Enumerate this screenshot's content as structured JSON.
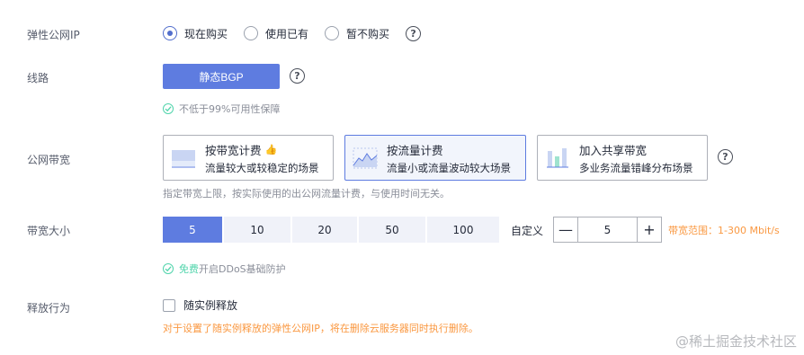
{
  "eip": {
    "label": "弹性公网IP",
    "options": [
      {
        "label": "现在购买",
        "selected": true
      },
      {
        "label": "使用已有",
        "selected": false
      },
      {
        "label": "暂不购买",
        "selected": false
      }
    ]
  },
  "line": {
    "label": "线路",
    "button": "静态BGP",
    "note": "不低于99%可用性保障"
  },
  "bandwidth": {
    "label": "公网带宽",
    "cards": [
      {
        "title": "按带宽计费",
        "subtitle": "流量较大或较稳定的场景",
        "selected": false,
        "icon": "bandwidth-billing-icon"
      },
      {
        "title": "按流量计费",
        "subtitle": "流量小或流量波动较大场景",
        "selected": true,
        "icon": "traffic-billing-icon"
      },
      {
        "title": "加入共享带宽",
        "subtitle": "多业务流量错峰分布场景",
        "selected": false,
        "icon": "shared-bandwidth-icon"
      }
    ],
    "hint": "指定带宽上限，按实际使用的出公网流量计费，与使用时间无关。"
  },
  "size": {
    "label": "带宽大小",
    "options": [
      "5",
      "10",
      "20",
      "50",
      "100"
    ],
    "selected_index": 0,
    "custom_label": "自定义",
    "custom_value": "5",
    "range_hint": "带宽范围：1-300 Mbit/s",
    "ddos_free": "免费",
    "ddos_rest": "开启DDoS基础防护"
  },
  "release": {
    "label": "释放行为",
    "checkbox_label": "随实例释放",
    "checked": false,
    "warning": "对于设置了随实例释放的弹性公网IP，将在删除云服务器同时执行删除。"
  },
  "watermark": "@稀土掘金技术社区",
  "colors": {
    "primary": "#5e7ce0",
    "warning": "#fa9841",
    "success": "#50d4ab"
  }
}
